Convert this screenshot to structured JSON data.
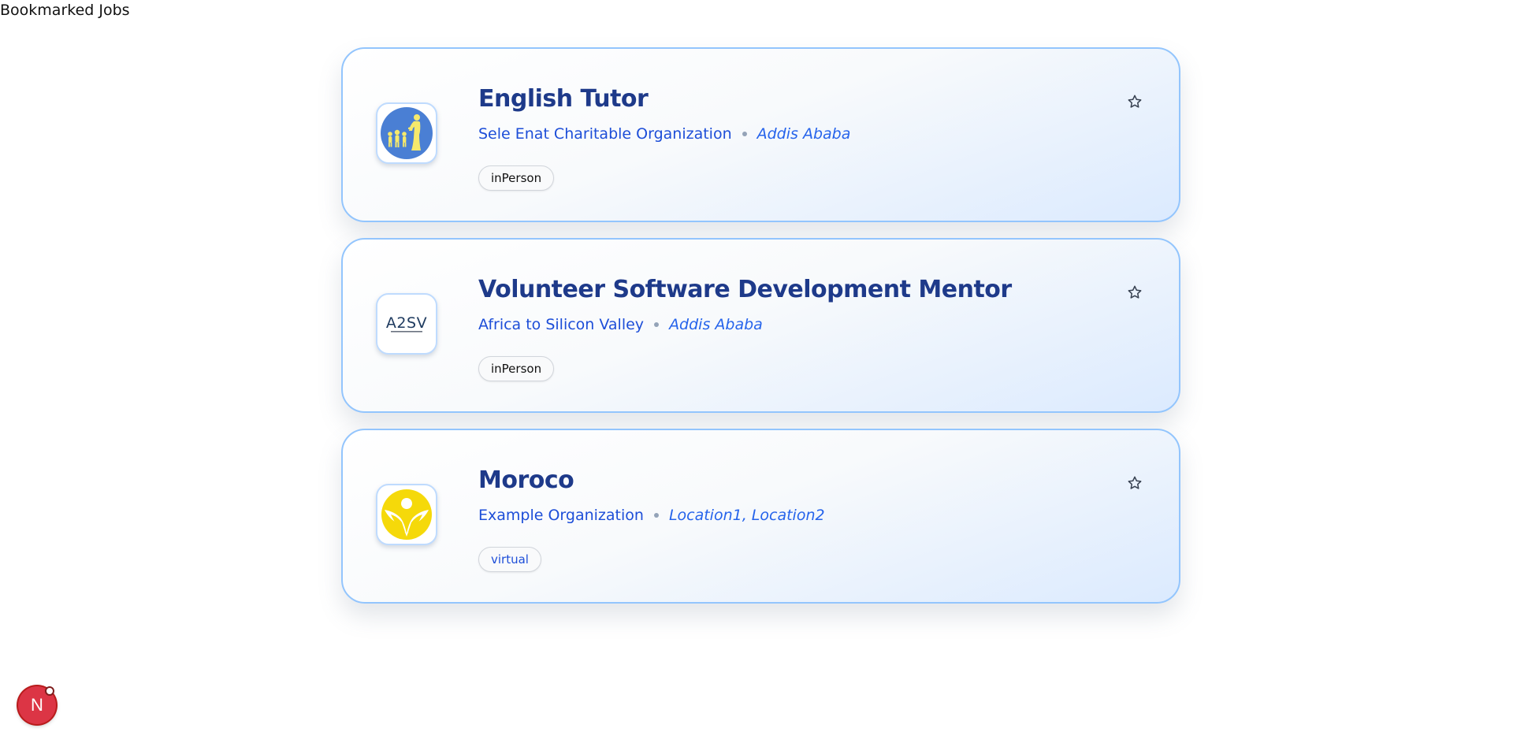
{
  "page": {
    "heading": "Bookmarked Jobs"
  },
  "jobs": [
    {
      "title": "English Tutor",
      "organization": "Sele Enat Charitable Organization",
      "location": "Addis Ababa",
      "mode": "inPerson",
      "logo_icon": "children-with-adult-logo-icon",
      "bookmark_icon": "star-outline-icon"
    },
    {
      "title": "Volunteer Software Development Mentor",
      "organization": "Africa to Silicon Valley",
      "location": "Addis Ababa",
      "mode": "inPerson",
      "logo_icon": "a2sv-logo-icon",
      "logo_text": "A2SV",
      "bookmark_icon": "star-outline-icon"
    },
    {
      "title": "Moroco",
      "organization": "Example Organization",
      "location": "Location1, Location2",
      "mode": "virtual",
      "logo_icon": "yellow-figure-logo-icon",
      "bookmark_icon": "star-outline-icon"
    }
  ],
  "dev_indicator": {
    "letter": "N",
    "icon": "nextjs-dev-indicator-icon"
  },
  "colors": {
    "title": "#1e3a8a",
    "organization": "#1d4ed8",
    "location": "#2563eb",
    "card_border": "#93c5fd",
    "dev_indicator": "#dc3545"
  }
}
